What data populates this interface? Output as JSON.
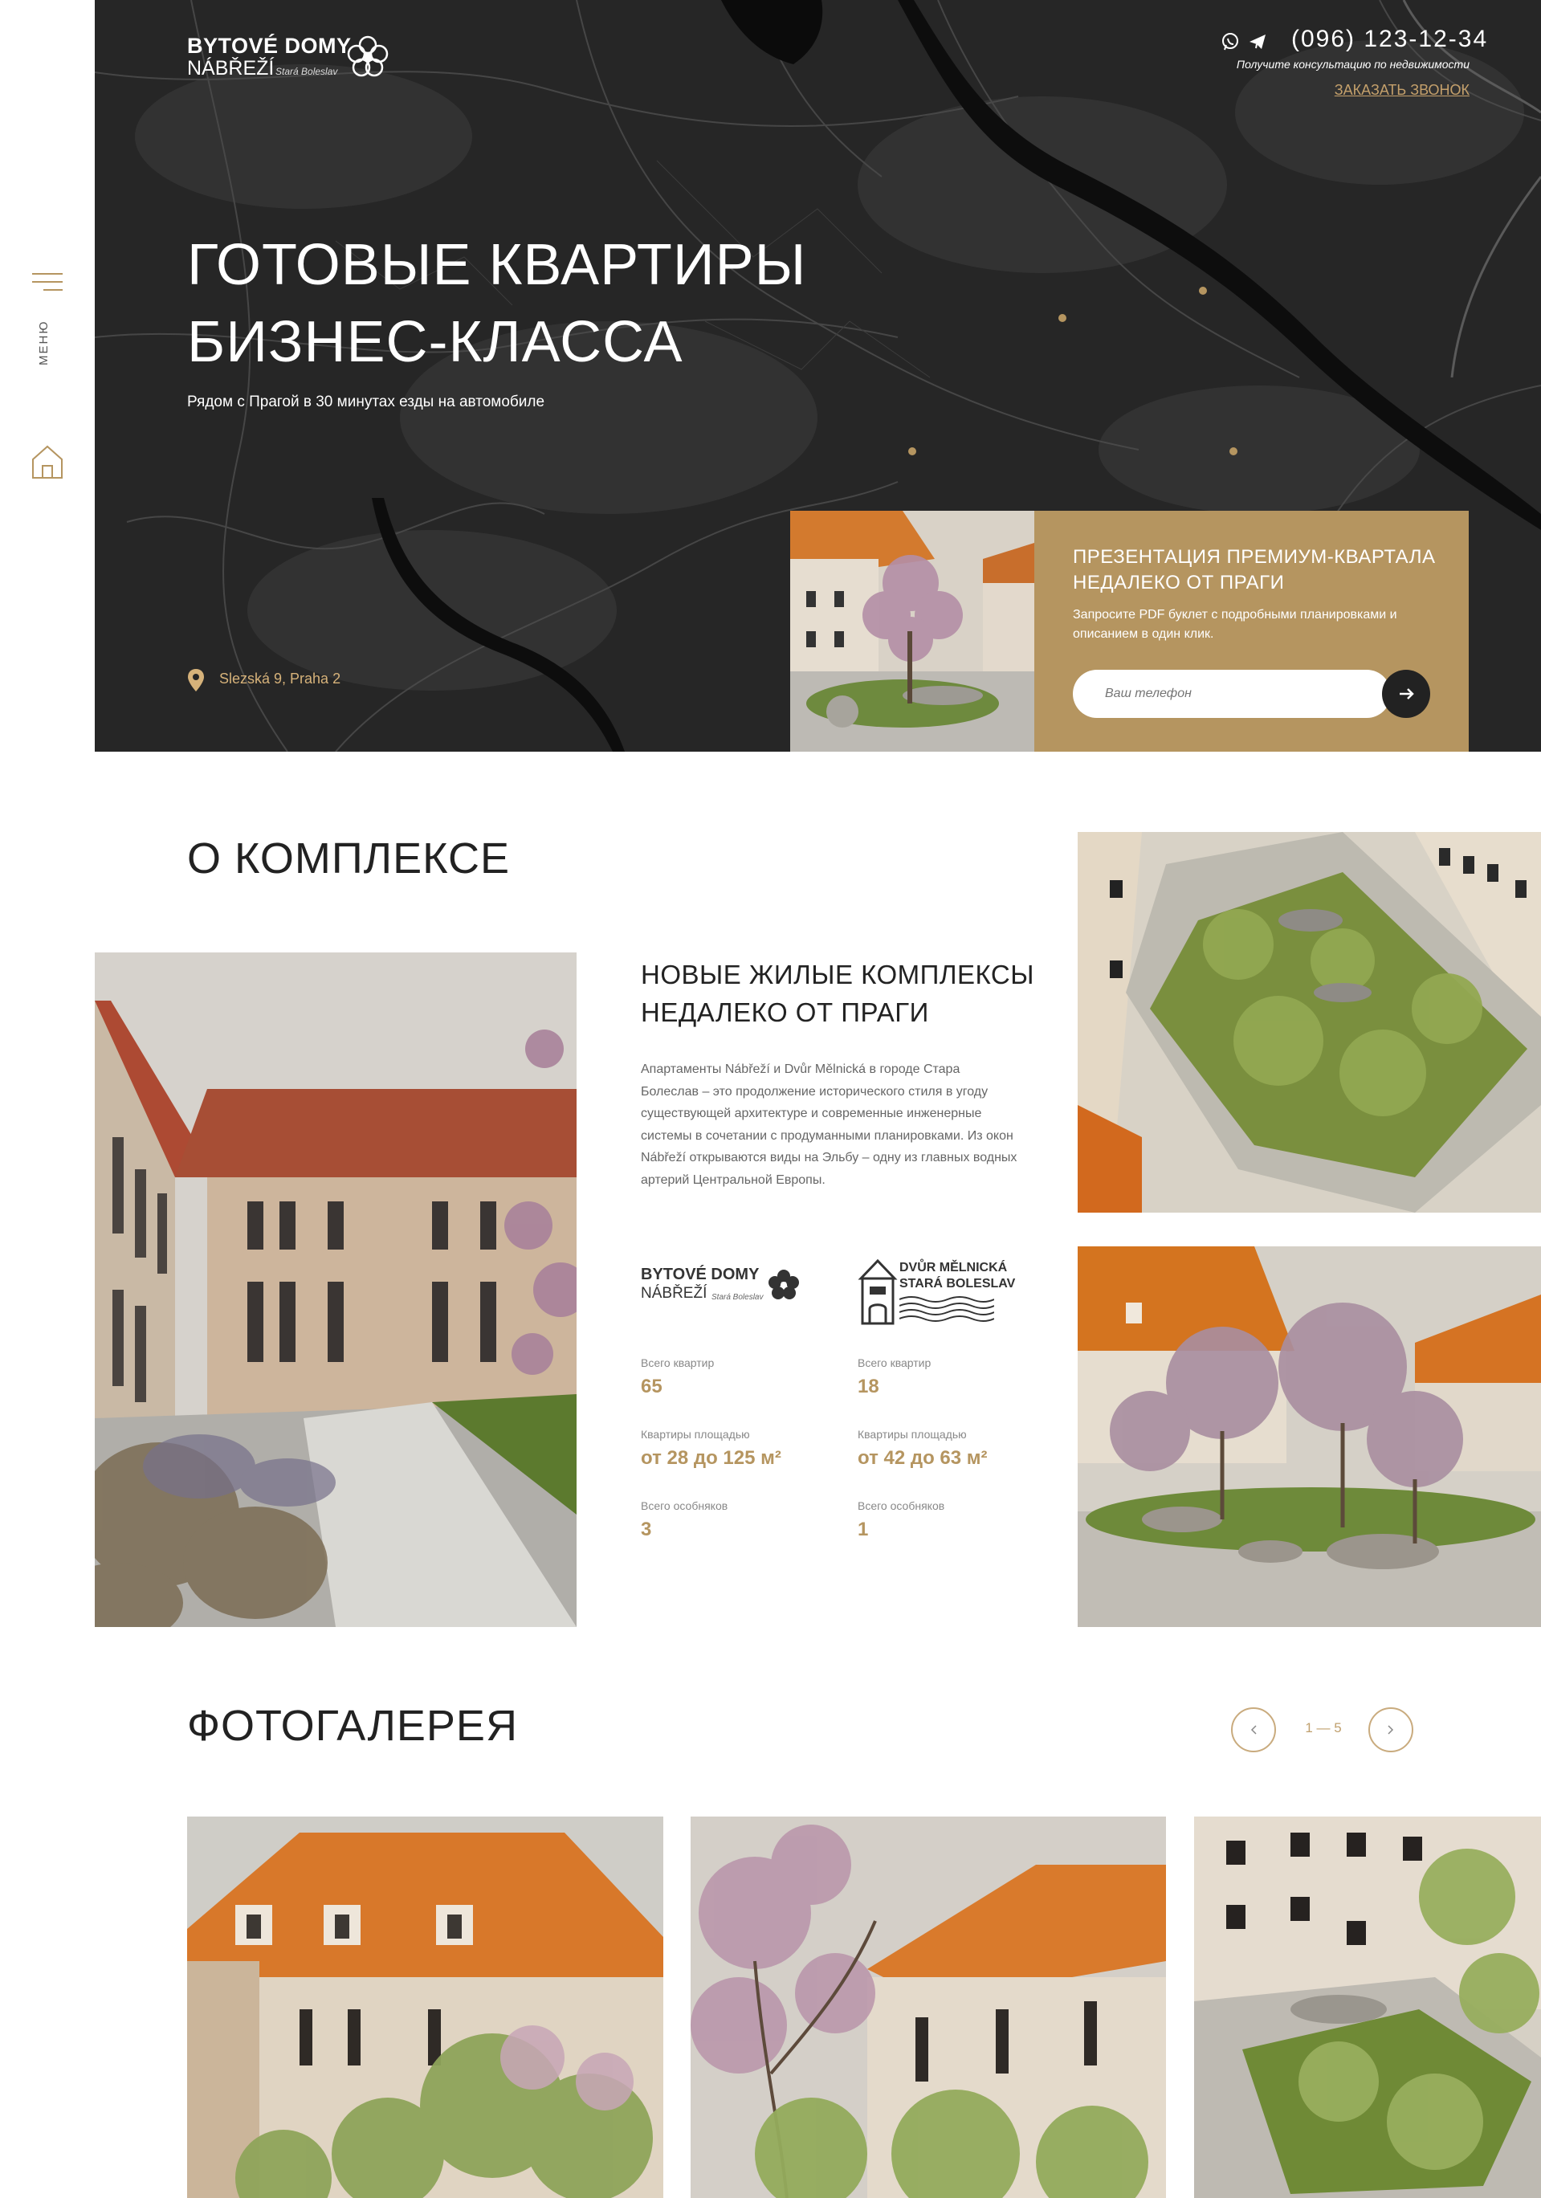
{
  "sidebar": {
    "menu_label": "МЕНЮ"
  },
  "header": {
    "logo_line1": "BYTOVÉ DOMY",
    "logo_line2": "NÁBŘEŽÍ",
    "logo_sub": "Stará Boleslav",
    "phone": "(096) 123-12-34",
    "phone_note": "Получите консультацию по недвижимости",
    "callback": "ЗАКАЗАТЬ ЗВОНОК"
  },
  "hero": {
    "title_line1": "ГОТОВЫЕ КВАРТИРЫ",
    "title_line2": "БИЗНЕС-КЛАССА",
    "subtitle": "Рядом с Прагой в 30 минутах езды на автомобиле",
    "address": "Slezská 9, Praha 2"
  },
  "promo": {
    "title": "ПРЕЗЕНТАЦИЯ ПРЕМИУМ-КВАРТАЛА НЕДАЛЕКО ОТ ПРАГИ",
    "text": "Запросите PDF буклет с подробными планировками и описанием в один клик.",
    "input_placeholder": "Ваш телефон"
  },
  "about": {
    "title": "О КОМПЛЕКСЕ",
    "subtitle_line1": "НОВЫЕ ЖИЛЫЕ КОМПЛЕКСЫ",
    "subtitle_line2": "НЕДАЛЕКО ОТ ПРАГИ",
    "text": "Апартаменты Nábřeží и Dvůr Mělnická в городе Стара Болеслав – это продолжение исторического стиля в угоду существующей архитектуре и современные инженерные системы в сочетании с продуманными планировками. Из окон Nábřeží открываются виды на Эльбу – одну из главных водных артерий Центральной Европы.",
    "complex1": {
      "logo_line1": "BYTOVÉ DOMY",
      "logo_line2": "NÁBŘEŽÍ",
      "logo_sub": "Stará Boleslav",
      "stats": [
        {
          "label": "Всего квартир",
          "value": "65"
        },
        {
          "label": "Квартиры площадью",
          "value": "от 28 до 125 м²"
        },
        {
          "label": "Всего особняков",
          "value": "3"
        }
      ]
    },
    "complex2": {
      "logo_line1": "DVŮR MĚLNICKÁ",
      "logo_line2": "STARÁ BOLESLAV",
      "stats": [
        {
          "label": "Всего квартир",
          "value": "18"
        },
        {
          "label": "Квартиры площадью",
          "value": "от 42 до 63 м²"
        },
        {
          "label": "Всего особняков",
          "value": "1"
        }
      ]
    }
  },
  "gallery": {
    "title": "ФОТОГАЛЕРЕЯ",
    "counter": "1 — 5"
  },
  "colors": {
    "accent": "#b59560",
    "hero_bg": "#252525",
    "text_dark": "#222222",
    "stat_value": "#b59560"
  }
}
